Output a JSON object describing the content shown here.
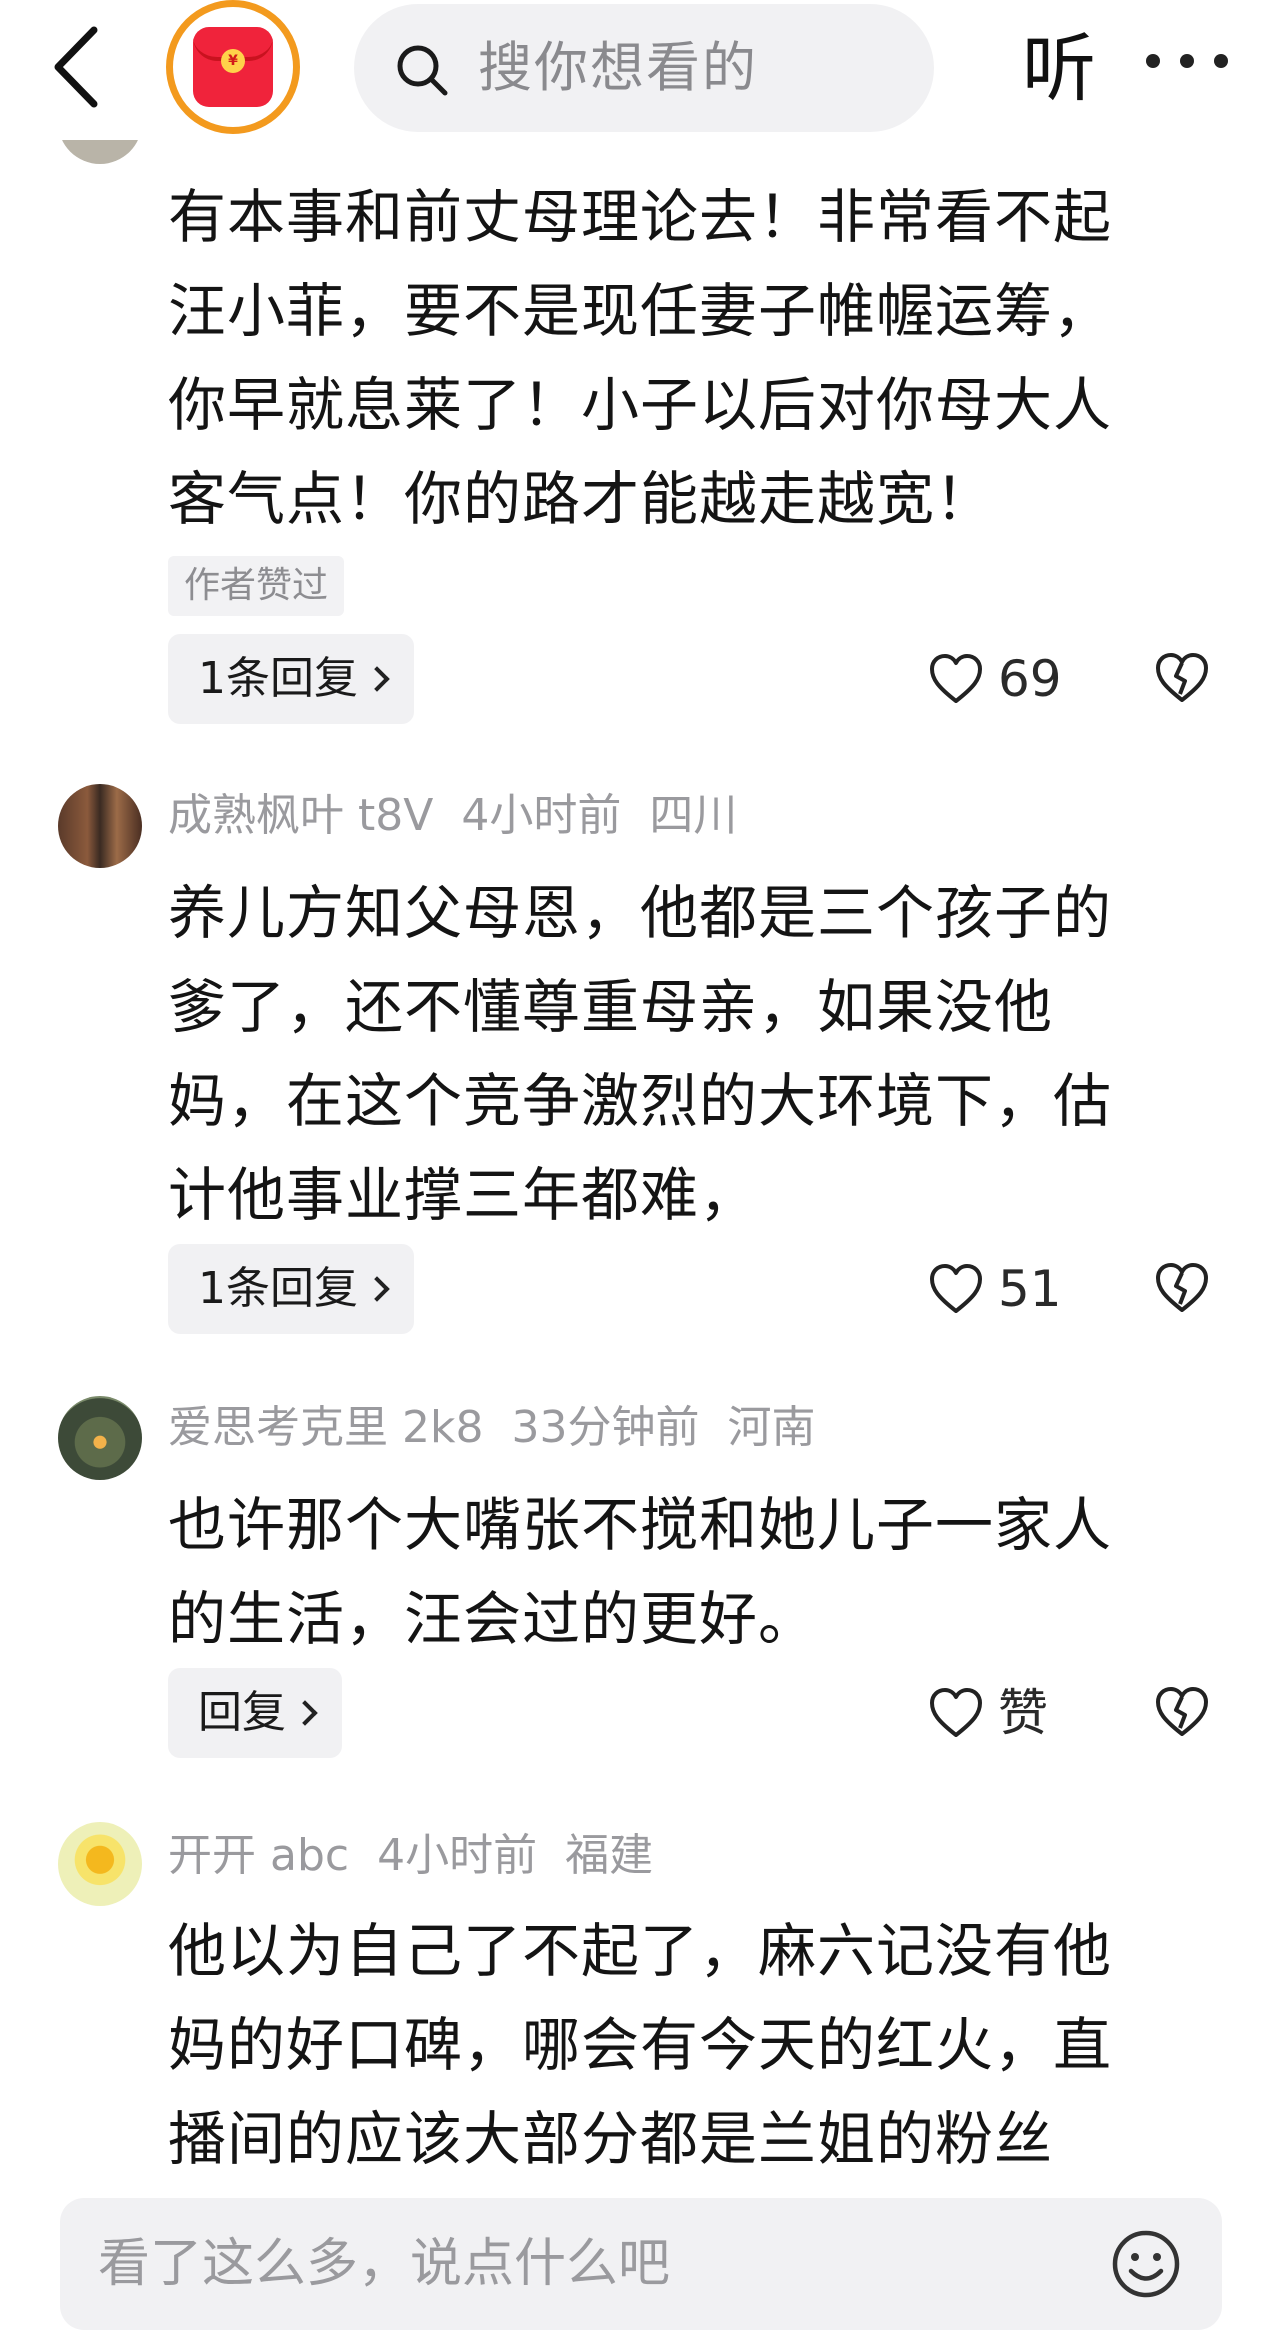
{
  "topbar": {
    "search_placeholder": "搜你想看的",
    "listen_label": "听",
    "icons": [
      "back-chevron-icon",
      "red-envelope-icon",
      "search-icon",
      "more-dots-icon"
    ]
  },
  "comments": [
    {
      "text": "有本事和前丈母理论去！非常看不起\n汪小菲，要不是现任妻子帷幄运筹，\n你早就息莱了！小子以后对你母大人\n客气点！你的路才能越走越宽！",
      "badge": "作者赞过",
      "reply_label": "1条回复",
      "likes": "69"
    },
    {
      "username": "成熟枫叶 t8V",
      "time": "4小时前",
      "location": "四川",
      "text": "养儿方知父母恩，他都是三个孩子的\n爹了，还不懂尊重母亲，如果没他\n妈，在这个竞争激烈的大环境下，估\n计他事业撑三年都难，",
      "reply_label": "1条回复",
      "likes": "51"
    },
    {
      "username": "爱思考克里 2k8",
      "time": "33分钟前",
      "location": "河南",
      "text": "也许那个大嘴张不搅和她儿子一家人\n的生活，汪会过的更好。",
      "reply_label": "回复",
      "likes": "赞"
    },
    {
      "username": "开开 abc",
      "time": "4小时前",
      "location": "福建",
      "text": "他以为自己了不起了，麻六记没有他\n妈的好口碑，哪会有今天的红火，直\n播间的应该大部分都是兰姐的粉丝"
    }
  ],
  "input": {
    "placeholder": "看了这么多，说点什么吧"
  },
  "colors": {
    "accent_orange": "#f39a1e",
    "red_envelope": "#f0233b",
    "meta_gray": "#9a9a9e",
    "pill_bg": "#f1f1f3"
  }
}
